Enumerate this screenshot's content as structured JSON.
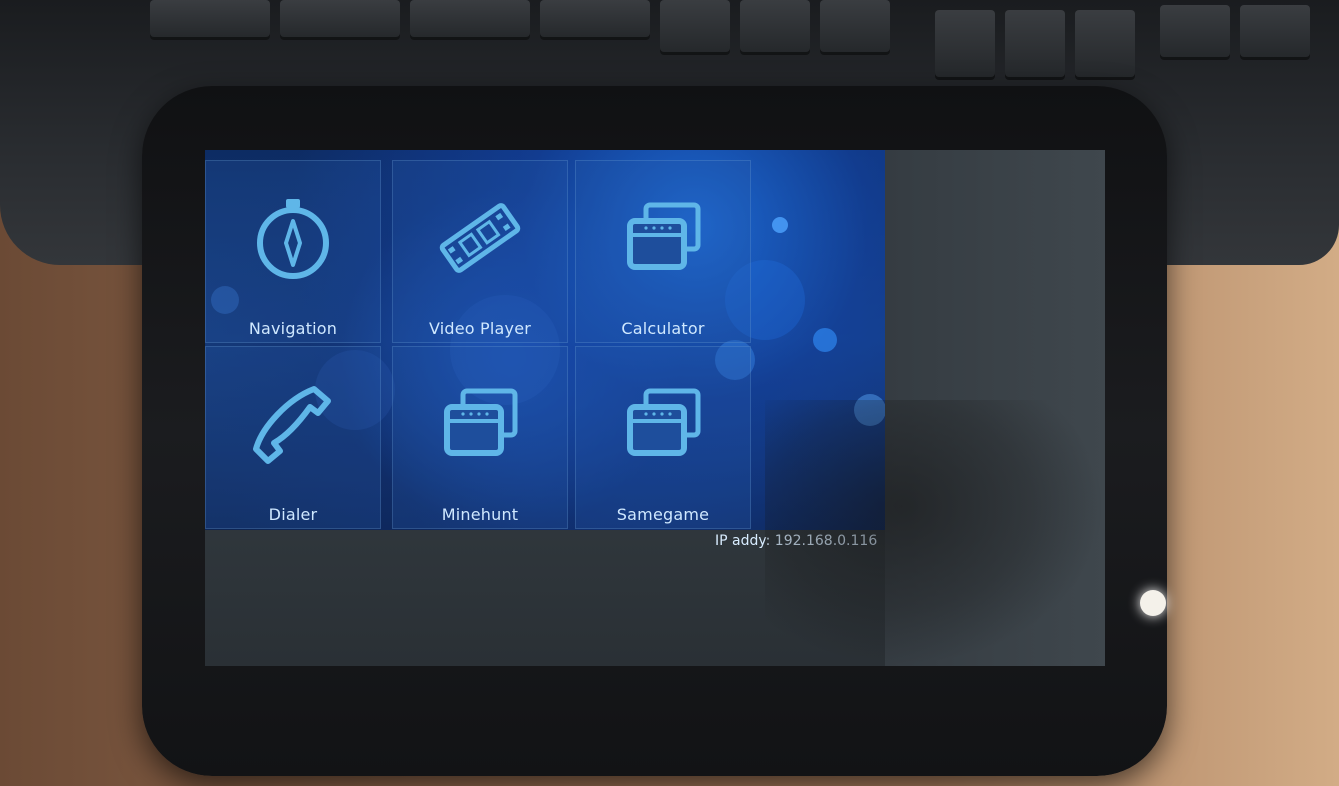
{
  "launcher": {
    "apps": [
      {
        "label": "Navigation",
        "icon": "compass-icon"
      },
      {
        "label": "Video Player",
        "icon": "film-strip-icon"
      },
      {
        "label": "Calculator",
        "icon": "windows-icon"
      },
      {
        "label": "Dialer",
        "icon": "phone-icon"
      },
      {
        "label": "Minehunt",
        "icon": "windows-icon"
      },
      {
        "label": "Samegame",
        "icon": "windows-icon"
      }
    ],
    "ip_text": "IP addy: 192.168.0.116"
  },
  "colors": {
    "accent": "#5fb6e8",
    "label": "#cfe8ff",
    "tile_bg": "#1e4e9c"
  }
}
